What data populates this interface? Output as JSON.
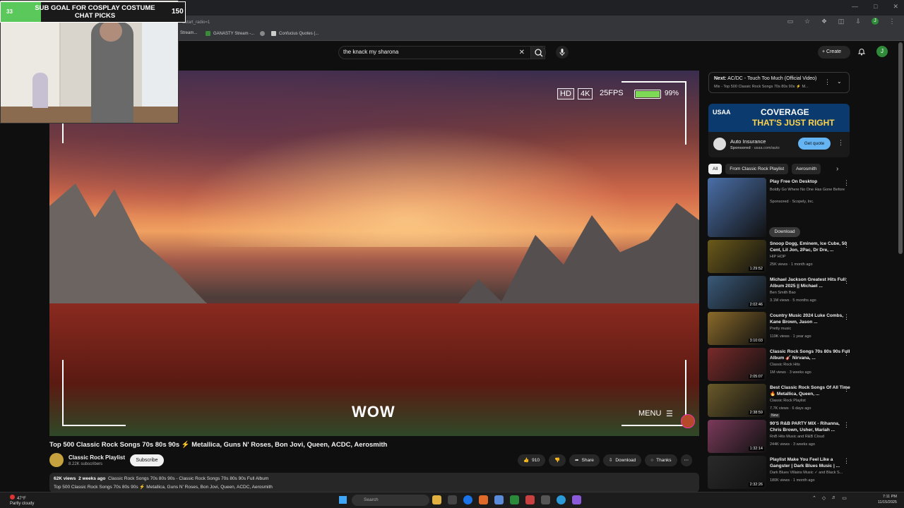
{
  "browser": {
    "url_fragment": "&start_radio=1",
    "bookmarks": [
      "Stream...",
      "GANASTY Stream -...",
      "Confucius Quotes (..."
    ]
  },
  "header": {
    "search_value": "the knack my sharona",
    "create_label": "Create",
    "avatar_letter": "J"
  },
  "overlay": {
    "goal_title_line1": "SUB GOAL FOR COSPLAY COSTUME",
    "goal_title_line2": "CHAT PICKS",
    "goal_current": "33",
    "goal_target": "150",
    "goal_progress": 0.22
  },
  "player": {
    "badge_hd": "HD",
    "badge_4k": "4K",
    "fps": "25FPS",
    "battery_pct": "99%",
    "battery_level": 0.99,
    "caption": "WOW",
    "menu_label": "MENU"
  },
  "video": {
    "title": "Top 500 Classic Rock Songs 70s 80s 90s ⚡ Metallica, Guns N' Roses, Bon Jovi, Queen, ACDC, Aerosmith",
    "channel": "Classic Rock Playlist",
    "subscribers": "8.22K subscribers",
    "subscribe_label": "Subscribe",
    "likes": "910",
    "share_label": "Share",
    "download_label": "Download",
    "thanks_label": "Thanks",
    "views": "62K views",
    "age": "2 weeks ago",
    "tags": "Classic Rock Songs 70s 80s 90s - Classic Rock Songs 70s 80s 90s Full Album",
    "desc_line": "Top 500 Classic Rock Songs 70s 80s 90s ⚡ Metallica, Guns N' Roses, Bon Jovi, Queen, ACDC, Aerosmith"
  },
  "next": {
    "label": "Next:",
    "title": "AC/DC - Touch Too Much (Official Video)",
    "subtitle": "Mix - Top 500 Classic Rock Songs 70s 80s 90s ⚡ M..."
  },
  "ad": {
    "brand": "USAA",
    "headline1": "COVERAGE",
    "headline2": "THAT'S JUST RIGHT",
    "name": "Auto Insurance",
    "sponsored": "Sponsored",
    "domain": "· usaa.com/auto",
    "cta": "Get quote"
  },
  "chips": [
    "All",
    "From Classic Rock Playlist",
    "Aerosmith"
  ],
  "recommendations": [
    {
      "title": "Play Free On Desktop",
      "channel": "Boldly Go Where No One Has Gone Before",
      "views": "Sponsored · Scopely, Inc.",
      "duration": "",
      "action": "Download",
      "color": "#4a6fa8"
    },
    {
      "title": "Snoop Dogg, Eminem, Ice Cube, 50 Cent, Lil Jon, 2Pac, Dr Dre, ...",
      "channel": "HIP HOP",
      "views": "25K views · 1 month ago",
      "duration": "1:29:52",
      "color": "#6b5a1a"
    },
    {
      "title": "Michael Jackson Greatest Hits Full Album 2025 || Michael ...",
      "channel": "Ben Smith Bao",
      "views": "3.1M views · 5 months ago",
      "duration": "2:02:46",
      "color": "#3a5a7a"
    },
    {
      "title": "Country Music 2024 Luke Combs, Kane Brown, Jason ...",
      "channel": "Pretty music",
      "views": "119K views · 1 year ago",
      "duration": "3:10:03",
      "color": "#8a6a2a"
    },
    {
      "title": "Classic Rock Songs 70s 80s 90s Full Album 🎸 Nirvana, ...",
      "channel": "Classic Rock Hits",
      "views": "1M views · 3 weeks ago",
      "duration": "2:05:07",
      "color": "#7a2a2a"
    },
    {
      "title": "Best Classic Rock Songs Of All Time 🔥 Metallica, Queen, ...",
      "channel": "Classic Rock Playlist",
      "views": "7.7K views · 6 days ago",
      "duration": "2:38:59",
      "badge": "New",
      "color": "#6a5a2a"
    },
    {
      "title": "90'S R&B PARTY MIX - Rihanna, Chris Brown, Usher, Mariah ...",
      "channel": "RnB Hits Music and R&B Cloud",
      "views": "244K views · 3 weeks ago",
      "duration": "1:32:14",
      "color": "#7a3a5a"
    },
    {
      "title": "Playlist Make You Feel Like a Gangster | Dark Blues Music | ...",
      "channel": "Dark Blues Villains Music ✓ and Black S...",
      "views": "180K views · 1 month ago",
      "duration": "2:32:26",
      "color": "#2a2a2a"
    }
  ],
  "taskbar": {
    "temp": "47°F",
    "weather": "Partly cloudy",
    "search": "Search",
    "time": "7:11 PM",
    "date": "11/15/2025"
  }
}
